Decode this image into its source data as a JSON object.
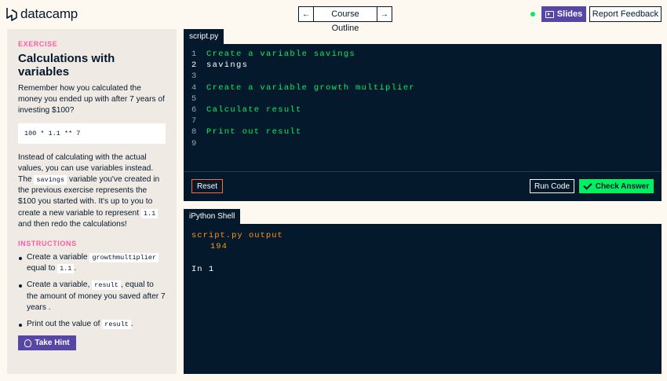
{
  "header": {
    "brand": "datacamp",
    "course_outline": "Course Outline",
    "prev_icon": "arrow-left-icon",
    "next_icon": "arrow-right-icon",
    "prev_glyph": "←",
    "next_glyph": "→",
    "slides_label": "Slides",
    "report_label": "Report Feedback"
  },
  "exercise": {
    "label": "EXERCISE",
    "title": "Calculations with variables",
    "intro": "Remember how you calculated the money you ended up with after 7 years of investing $100?",
    "code_example": "100 * 1.1 ** 7",
    "body_1": "Instead of calculating with the actual values, you can use variables instead. The",
    "body_code_1": "savings",
    "body_2": "variable you've created in the previous exercise represents the $100 you started with. It's up to you to create a new variable to represent",
    "body_code_2": "1.1",
    "body_3": "and then redo the calculations!",
    "instructions_label": "INSTRUCTIONS",
    "instructions": [
      {
        "pre": "Create a variable",
        "code": "growthmultiplier",
        "mid": "equal to",
        "code2": "1.1",
        "post": "."
      },
      {
        "pre": "Create a variable,",
        "code": "result",
        "post": ", equal to the amount of money you saved after 7 years ."
      },
      {
        "pre": "Print out the value of",
        "code": "result",
        "post": "."
      }
    ],
    "hint_label": "Take Hint"
  },
  "editor": {
    "tab_label": "script.py",
    "lines": [
      {
        "n": "1",
        "text": "Create a variable savings",
        "kind": "comment"
      },
      {
        "n": "2",
        "text": "savings",
        "kind": "plain"
      },
      {
        "n": "3",
        "text": "",
        "kind": "plain"
      },
      {
        "n": "4",
        "text": "Create a variable growth multiplier",
        "kind": "comment"
      },
      {
        "n": "5",
        "text": "",
        "kind": "plain"
      },
      {
        "n": "6",
        "text": "Calculate result",
        "kind": "comment"
      },
      {
        "n": "7",
        "text": "",
        "kind": "plain"
      },
      {
        "n": "8",
        "text": "Print out result",
        "kind": "comment"
      },
      {
        "n": "9",
        "text": "",
        "kind": "plain"
      }
    ],
    "reset_label": "Reset",
    "run_label": "Run Code",
    "check_label": "Check Answer"
  },
  "shell": {
    "tab_label": "iPython Shell",
    "output_header": "script.py output",
    "output_value": "194",
    "prompt": "In 1"
  },
  "colors": {
    "navy": "#05192d",
    "green": "#03ef62",
    "purple": "#5646a5",
    "pink": "#ff5ba2",
    "orange": "#ff931e"
  }
}
